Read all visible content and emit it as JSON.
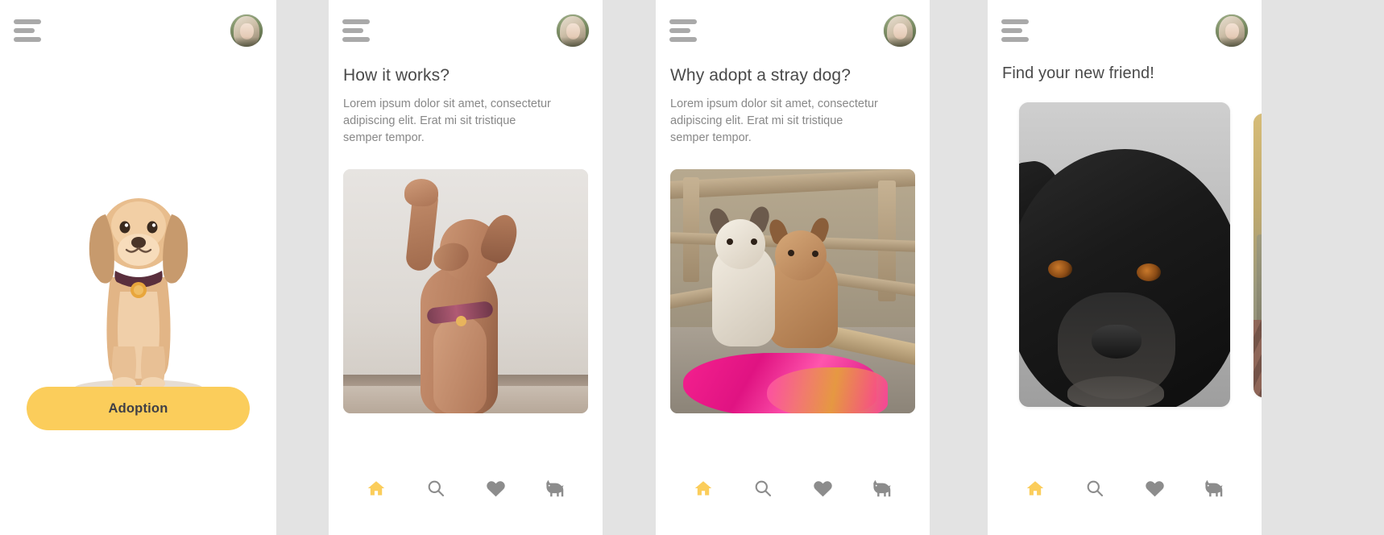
{
  "background_color": "#e3e3e3",
  "accent_color": "#fbcd5b",
  "screens": [
    {
      "id": "onboarding-hero",
      "header": {
        "menu_icon": "hamburger-menu-icon",
        "avatar": "user-avatar"
      },
      "cta_label": "Adoption",
      "hero_image_alt": "golden-retriever-puppy-sitting"
    },
    {
      "id": "how-it-works",
      "header": {
        "menu_icon": "hamburger-menu-icon",
        "avatar": "user-avatar"
      },
      "title": "How it works?",
      "body": "Lorem ipsum dolor sit amet, consectetur adipiscing elit. Erat mi sit tristique semper tempor.",
      "photo_alt": "dog-raising-paw-against-white-wall"
    },
    {
      "id": "why-adopt",
      "header": {
        "menu_icon": "hamburger-menu-icon",
        "avatar": "user-avatar"
      },
      "title": "Why adopt a stray dog?",
      "body": "Lorem ipsum dolor sit amet, consectetur adipiscing elit. Erat mi sit tristique semper tempor.",
      "photo_alt": "two-stray-puppies-on-pink-cloth"
    },
    {
      "id": "find-friend",
      "header": {
        "menu_icon": "hamburger-menu-icon",
        "avatar": "user-avatar"
      },
      "title": "Find your new friend!",
      "photo_alt": "black-dog-portrait",
      "next_photo_alt": "dog-by-yellow-wall"
    }
  ],
  "bottom_nav": {
    "items": [
      {
        "icon": "home-icon",
        "label": "Home",
        "active": true
      },
      {
        "icon": "search-icon",
        "label": "Search",
        "active": false
      },
      {
        "icon": "heart-icon",
        "label": "Favorites",
        "active": false
      },
      {
        "icon": "dog-icon",
        "label": "Pets",
        "active": false
      }
    ],
    "active_color": "#fbcd5b",
    "inactive_color": "#8c8c8c"
  }
}
